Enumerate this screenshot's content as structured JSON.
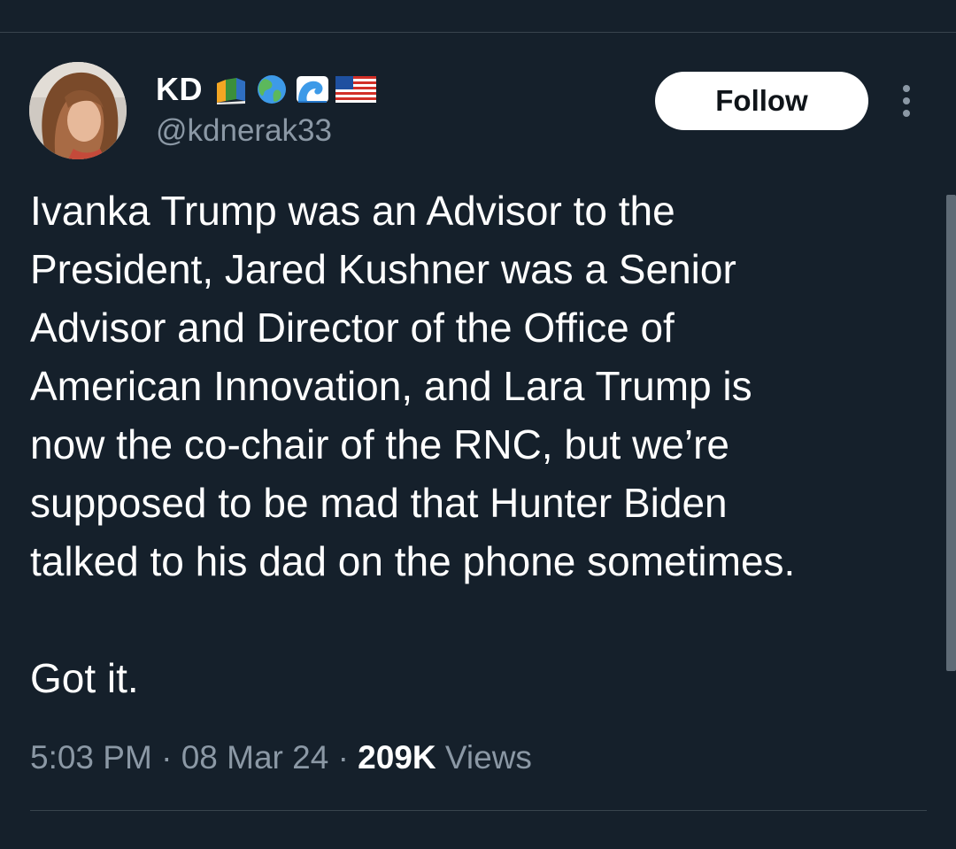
{
  "author": {
    "display_name": "KD",
    "handle": "@kdnerak33",
    "name_emojis": [
      "books-icon",
      "globe-americas-icon",
      "water-wave-icon",
      "us-flag-icon"
    ]
  },
  "actions": {
    "follow_label": "Follow"
  },
  "tweet": {
    "text": "Ivanka Trump was an Advisor to the\nPresident, Jared Kushner was a Senior\nAdvisor and Director of the Office of\nAmerican Innovation, and Lara Trump is\nnow the co-chair of the RNC, but we’re\nsupposed to be mad that Hunter Biden\ntalked to his dad on the phone sometimes.\n\nGot it.",
    "time": "5:03 PM",
    "date": "08 Mar 24",
    "separator": "·",
    "views_count": "209K",
    "views_label": "Views"
  },
  "colors": {
    "background": "#15202b",
    "text_primary": "#ffffff",
    "text_secondary": "#8b98a5",
    "divider": "#38444d",
    "follow_bg": "#ffffff",
    "follow_text": "#0f1419"
  }
}
